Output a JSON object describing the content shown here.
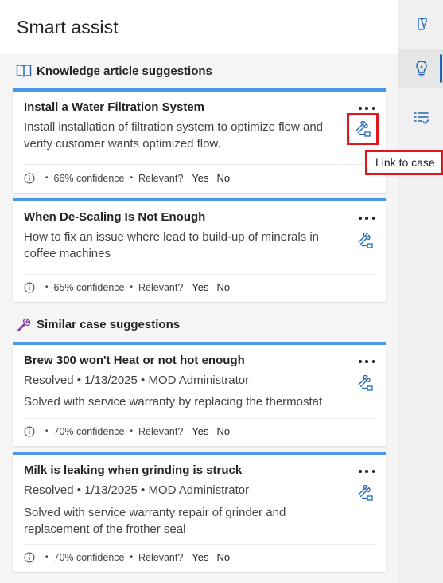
{
  "panel": {
    "title": "Smart assist"
  },
  "knowledge": {
    "section_title": "Knowledge article suggestions",
    "cards": [
      {
        "title": "Install a Water Filtration System",
        "description": "Install installation of filtration system to optimize flow and verify customer wants optimized flow.",
        "confidence": "66% confidence",
        "relevant": "Relevant?",
        "yes": "Yes",
        "no": "No"
      },
      {
        "title": "When De-Scaling Is Not Enough",
        "description": "How to fix an issue where lead to build-up of minerals in coffee machines",
        "confidence": "65% confidence",
        "relevant": "Relevant?",
        "yes": "Yes",
        "no": "No"
      }
    ]
  },
  "similar": {
    "section_title": "Similar case suggestions",
    "cards": [
      {
        "title": "Brew 300 won't Heat or not hot enough",
        "meta": "Resolved • 1/13/2025 • MOD Administrator",
        "description": "Solved with service warranty by replacing the thermostat",
        "confidence": "70% confidence",
        "relevant": "Relevant?",
        "yes": "Yes",
        "no": "No"
      },
      {
        "title": "Milk is leaking when grinding is struck",
        "meta": "Resolved • 1/13/2025 • MOD Administrator",
        "description": "Solved with service warranty repair of grinder and replacement of the frother seal",
        "confidence": "70% confidence",
        "relevant": "Relevant?",
        "yes": "Yes",
        "no": "No"
      }
    ]
  },
  "tooltip": {
    "text": "Link to case"
  },
  "rail": {
    "items": [
      "copilot-icon",
      "lightbulb-icon",
      "checklist-icon"
    ],
    "active": "lightbulb-icon"
  },
  "colors": {
    "accent": "#4a97e6",
    "link_icon": "#1e66b5",
    "highlight": "#e0161d",
    "rail_indicator": "#1e66b5"
  }
}
